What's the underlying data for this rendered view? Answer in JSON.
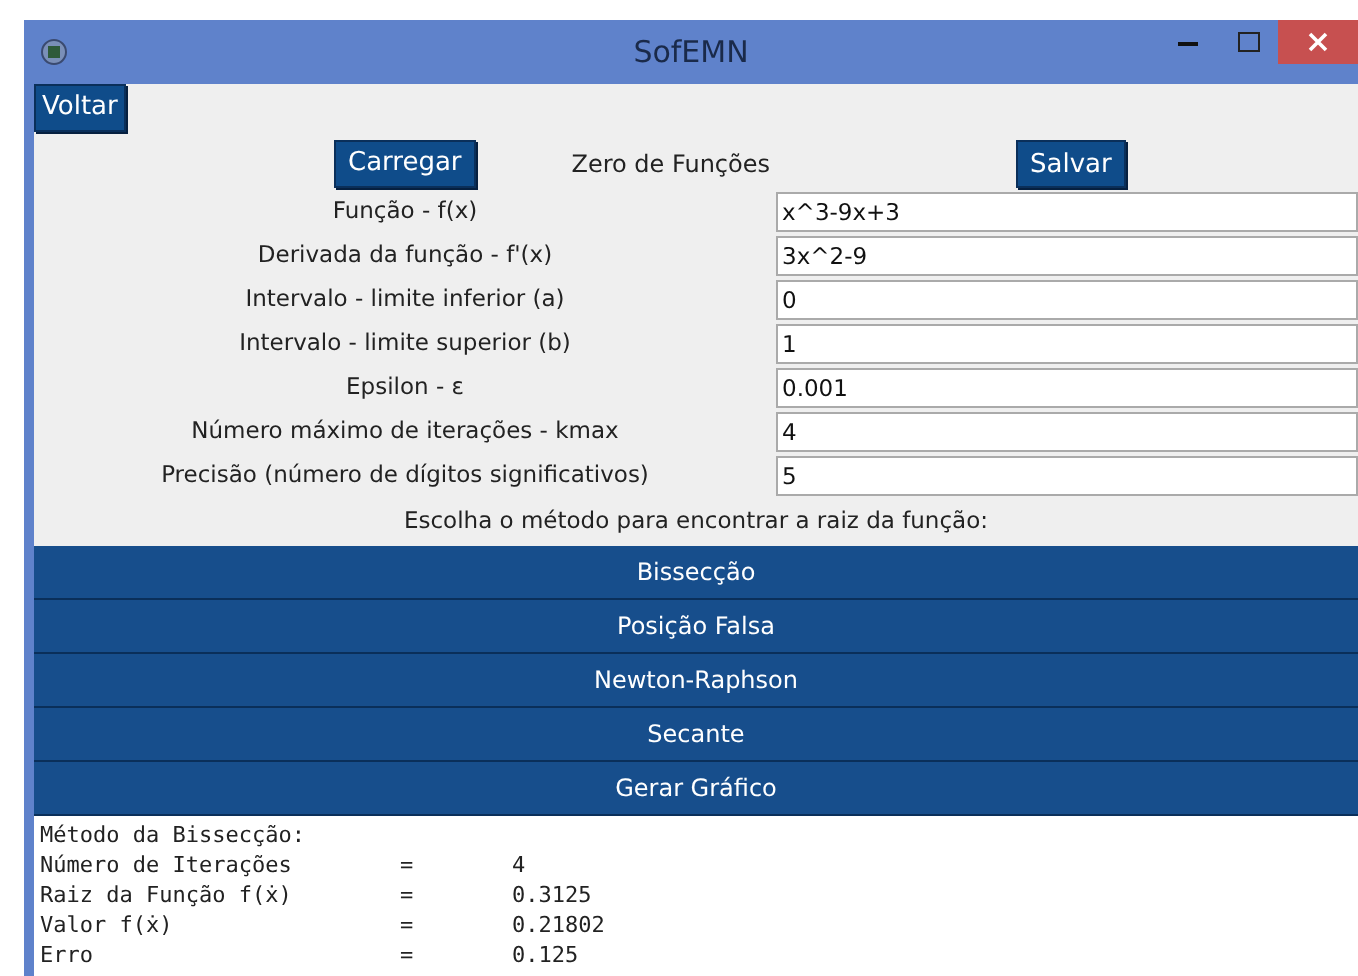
{
  "window": {
    "title": "SofEMN"
  },
  "back_button": "Voltar",
  "toolbar": {
    "load_button": "Carregar",
    "heading": "Zero de Funções",
    "save_button": "Salvar"
  },
  "fields": [
    {
      "label": "Função - f(x)",
      "value": "x^3-9x+3"
    },
    {
      "label": "Derivada da função - f'(x)",
      "value": "3x^2-9"
    },
    {
      "label": "Intervalo - limite inferior (a)",
      "value": "0"
    },
    {
      "label": "Intervalo - limite superior (b)",
      "value": "1"
    },
    {
      "label": "Epsilon - ε",
      "value": "0.001"
    },
    {
      "label": "Número máximo de iterações - kmax",
      "value": "4"
    },
    {
      "label": "Precisão (número de dígitos significativos)",
      "value": "5"
    }
  ],
  "method_prompt": "Escolha o método para encontrar a raiz da função:",
  "method_buttons": [
    "Bissecção",
    "Posição Falsa",
    "Newton-Raphson",
    "Secante",
    "Gerar Gráfico"
  ],
  "output": {
    "title": "Método da Bissecção:",
    "rows": [
      {
        "label": "Número de Iterações",
        "sign": "=",
        "value": "4"
      },
      {
        "label": "Raiz da Função f(ẋ)",
        "sign": "=",
        "value": "0.3125"
      },
      {
        "label": "Valor f(ẋ)",
        "sign": "=",
        "value": "0.21802"
      },
      {
        "label": "Erro",
        "sign": "=",
        "value": "0.125"
      }
    ]
  }
}
